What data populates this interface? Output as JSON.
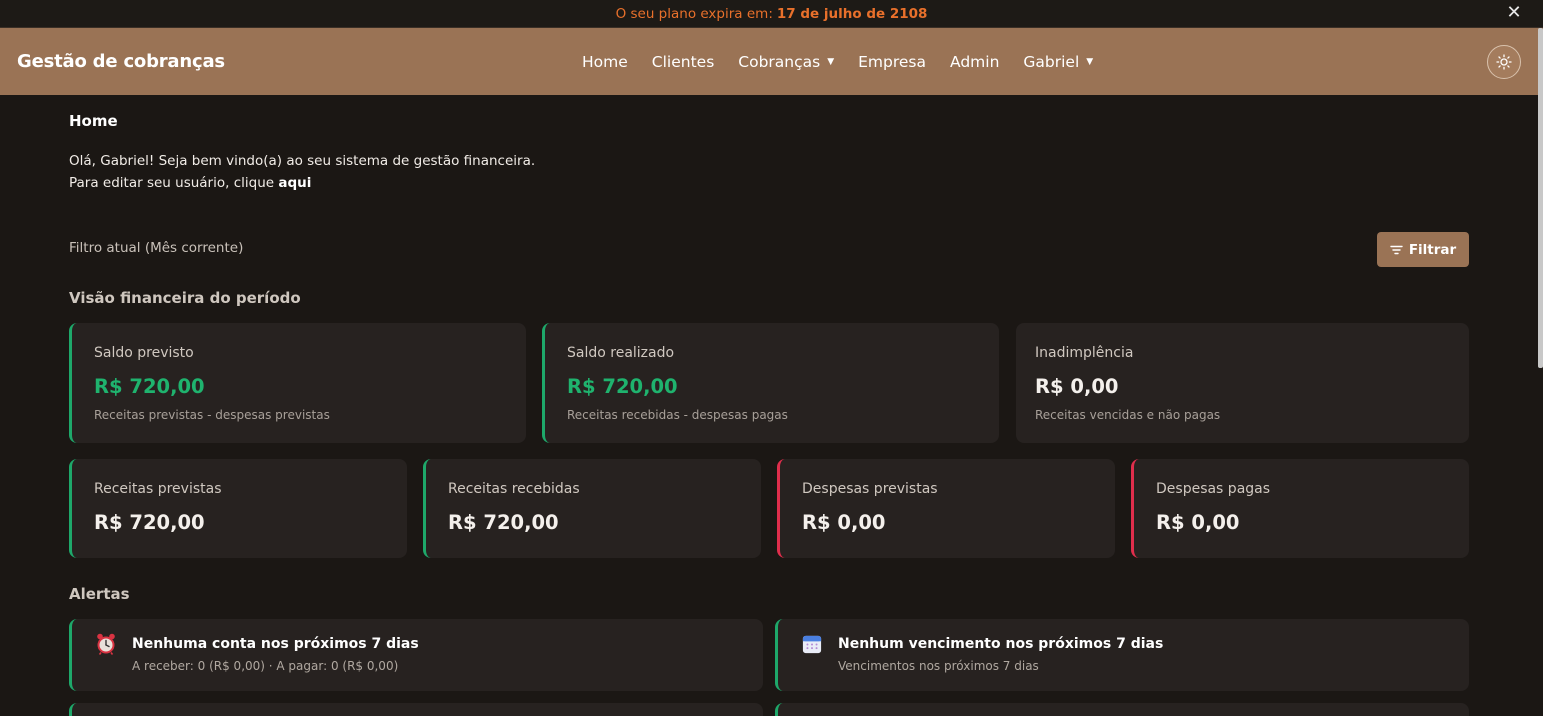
{
  "banner": {
    "text": "O seu plano expira em:",
    "date": "17 de julho de 2108",
    "close_icon": "close-icon"
  },
  "navbar": {
    "brand": "Gestão de cobranças",
    "items": [
      {
        "label": "Home"
      },
      {
        "label": "Clientes"
      },
      {
        "label": "Cobranças",
        "dropdown": true
      },
      {
        "label": "Empresa"
      },
      {
        "label": "Admin"
      },
      {
        "label": "Gabriel",
        "dropdown": true
      }
    ],
    "theme_icon": "sun-icon"
  },
  "home": {
    "title": "Home",
    "welcome": "Olá, Gabriel! Seja bem vindo(a) ao seu sistema de gestão financeira.",
    "edit_text": "Para editar seu usuário, clique",
    "edit_link": "aqui"
  },
  "filter": {
    "current": "Filtro atual (Mês corrente)",
    "button": "Filtrar",
    "icon": "filter-icon"
  },
  "overview": {
    "title": "Visão financeira do período",
    "cards": [
      {
        "label": "Saldo previsto",
        "value": "R$ 720,00",
        "sub": "Receitas previstas - despesas previstas",
        "accent": "#1ea86a"
      },
      {
        "label": "Saldo realizado",
        "value": "R$ 720,00",
        "sub": "Receitas recebidas - despesas pagas",
        "accent": "#1ea86a"
      },
      {
        "label": "Inadimplência",
        "value": "R$ 0,00",
        "sub": "Receitas vencidas e não pagas"
      }
    ],
    "small_cards": [
      {
        "label": "Receitas previstas",
        "value": "R$ 720,00",
        "accent": "#1ea86a"
      },
      {
        "label": "Receitas recebidas",
        "value": "R$ 720,00",
        "accent": "#1ea86a"
      },
      {
        "label": "Despesas previstas",
        "value": "R$ 0,00",
        "accent": "#e02e4c"
      },
      {
        "label": "Despesas pagas",
        "value": "R$ 0,00",
        "accent": "#e02e4c"
      }
    ]
  },
  "alerts": {
    "title": "Alertas",
    "items": [
      {
        "title": "Nenhuma conta nos próximos 7 dias",
        "sub": "A receber: 0 (R$ 0,00) · A pagar: 0 (R$ 0,00)",
        "icon": "alarm-clock-icon"
      },
      {
        "title": "Nenhum vencimento nos próximos 7 dias",
        "sub": "Vencimentos nos próximos 7 dias",
        "icon": "calendar-icon"
      }
    ]
  },
  "colors": {
    "brand": "#9a7355",
    "positive": "#1ea86a",
    "negative": "#e02e4c",
    "warning": "#e8702b"
  }
}
